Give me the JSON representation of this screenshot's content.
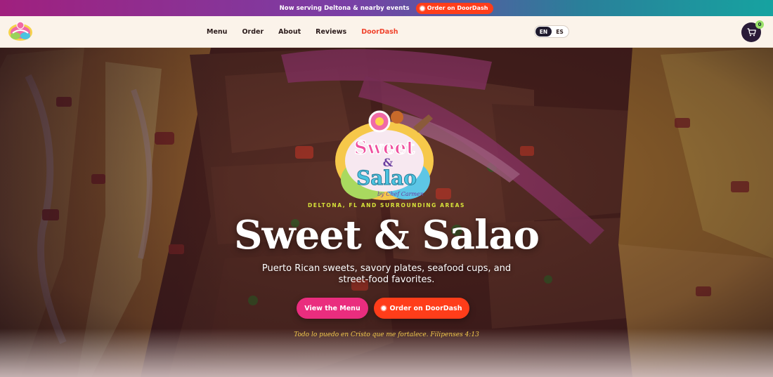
{
  "announcement": {
    "message": "Now serving Deltona & nearby events",
    "cta_label": "Order on DoorDash"
  },
  "header": {
    "logo_alt": "Sweet & Salao logo",
    "nav": [
      {
        "label": "Menu"
      },
      {
        "label": "Order"
      },
      {
        "label": "About"
      },
      {
        "label": "Reviews"
      },
      {
        "label": "DoorDash"
      }
    ],
    "lang": {
      "en": "EN",
      "es": "ES",
      "active": "EN"
    },
    "cart_count": "0"
  },
  "hero": {
    "logo_text": {
      "top": "Sweet",
      "amp": "&",
      "bottom": "Salao",
      "tag": "by Chef Carmen"
    },
    "eyebrow": "DELTONA, FL AND SURROUNDING AREAS",
    "title": "Sweet & Salao",
    "subtitle": "Puerto Rican sweets, savory plates, seafood cups, and street-food favorites.",
    "primary_button": "View the Menu",
    "secondary_button": "Order on DoorDash",
    "verse": "Todo lo puedo en Cristo que me fortalece. Filipenses 4:13"
  },
  "colors": {
    "accent_pink": "#ea2d7e",
    "doordash_red": "#ff3d1a",
    "eyebrow_yellow": "#d6e23a",
    "verse_gold": "#f2c94c",
    "header_bg": "#fbf3ea",
    "cart_bg": "#2a1b38"
  },
  "icons": [
    "cart-icon",
    "record-dot-icon"
  ]
}
